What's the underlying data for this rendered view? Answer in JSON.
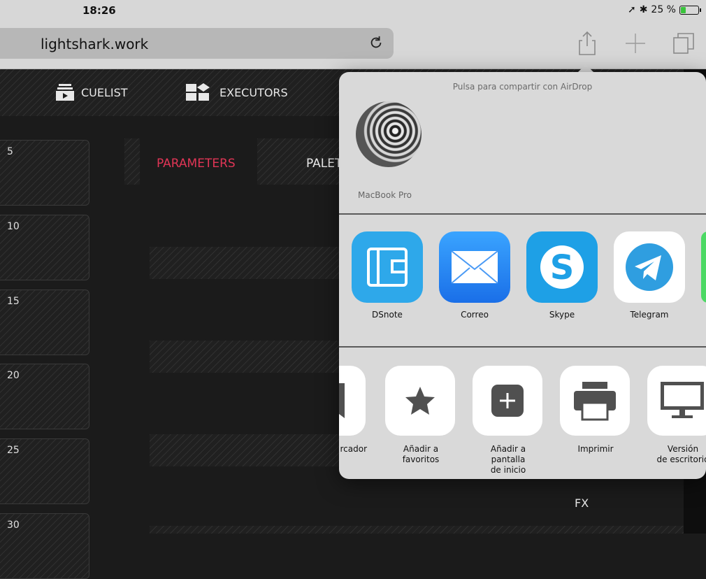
{
  "statusbar": {
    "time": "18:26",
    "battery": "25 %",
    "battery_level": 0.25
  },
  "browser": {
    "url": "lightshark.work"
  },
  "app": {
    "tabs": [
      {
        "label": "CUELIST"
      },
      {
        "label": "EXECUTORS"
      }
    ],
    "cues": [
      "5",
      "10",
      "15",
      "20",
      "25",
      "30"
    ],
    "parameters_label": "PARAMETERS",
    "palettes_label": "PALET",
    "fx_label": "FX"
  },
  "share": {
    "airdrop_hint": "Pulsa para compartir con AirDrop",
    "device_name": "MacBook Pro",
    "apps": [
      {
        "label": "DSnote",
        "icon": "dsnote-icon",
        "color": "#2ea8ea"
      },
      {
        "label": "Correo",
        "icon": "mail-icon",
        "color": "#1e88f5"
      },
      {
        "label": "Skype",
        "icon": "skype-icon",
        "color": "#1ea0e6"
      },
      {
        "label": "Telegram",
        "icon": "telegram-icon",
        "color": "#ffffff"
      }
    ],
    "actions": [
      {
        "label": "rcador",
        "icon": "bookmark-icon"
      },
      {
        "label": "Añadir a favoritos",
        "icon": "star-icon"
      },
      {
        "label": "Añadir a pantalla\nde inicio",
        "icon": "add-home-icon"
      },
      {
        "label": "Imprimir",
        "icon": "printer-icon"
      },
      {
        "label": "Versión\nde escritorio",
        "icon": "desktop-icon"
      }
    ]
  }
}
